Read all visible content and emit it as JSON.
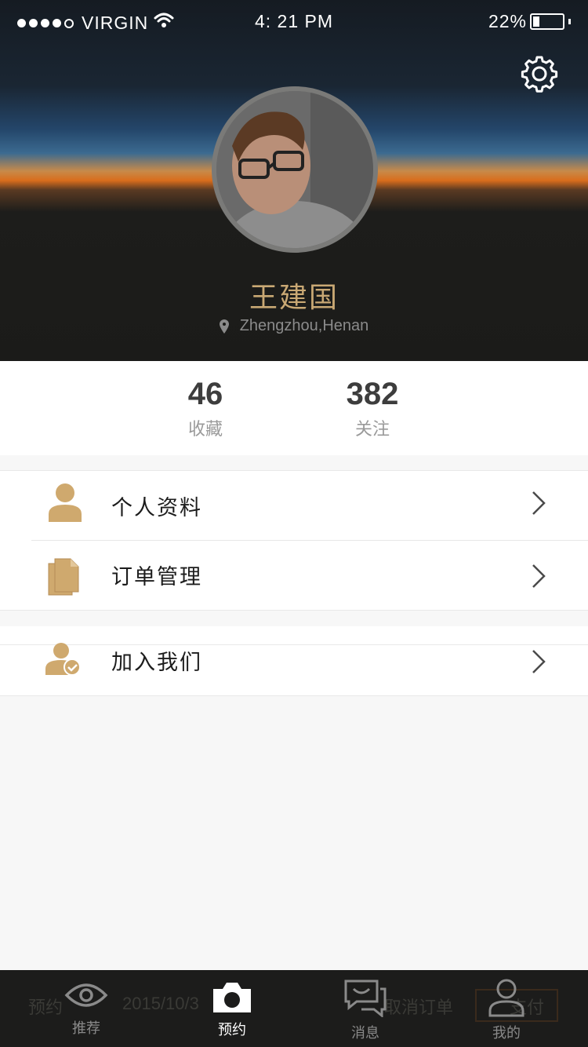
{
  "status_bar": {
    "carrier": "VIRGIN",
    "time": "4: 21 PM",
    "battery_pct": "22%",
    "battery_level": 0.22
  },
  "profile": {
    "name": "王建国",
    "location": "Zhengzhou,Henan"
  },
  "stats": [
    {
      "value": "46",
      "label": "收藏"
    },
    {
      "value": "382",
      "label": "关注"
    }
  ],
  "menu": [
    {
      "label": "个人资料",
      "icon": "person-icon"
    },
    {
      "label": "订单管理",
      "icon": "document-icon"
    },
    {
      "label": "加入我们",
      "icon": "person-check-icon"
    }
  ],
  "background_ghost": {
    "booking": "预约",
    "date": "2015/10/3",
    "cancel": "取消订单",
    "pay": "支付"
  },
  "tabs": [
    {
      "label": "推荐",
      "icon": "eye-icon",
      "active": false
    },
    {
      "label": "预约",
      "icon": "camera-icon",
      "active": true
    },
    {
      "label": "消息",
      "icon": "chat-icon",
      "active": false
    },
    {
      "label": "我的",
      "icon": "user-icon",
      "active": false
    }
  ],
  "colors": {
    "accent_gold": "#c9a874",
    "icon_tan": "#cfa96e",
    "tabbar_bg": "#1c1c1b"
  }
}
